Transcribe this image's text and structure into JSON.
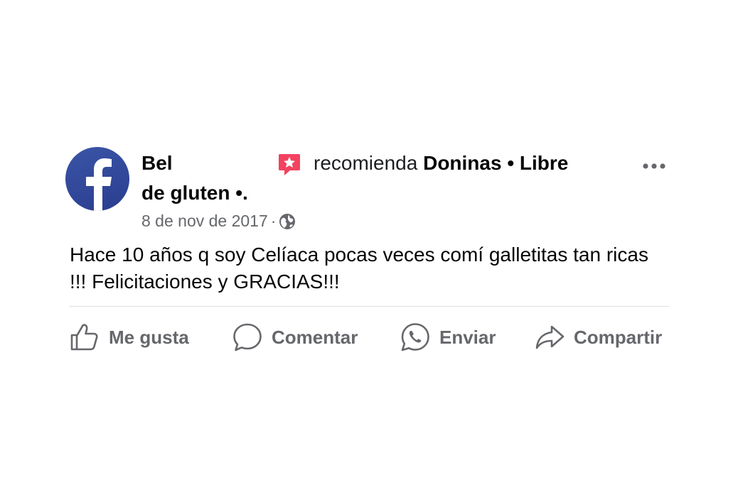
{
  "post": {
    "author_name_line1": "Bel",
    "author_name_line2": "de gluten",
    "author_suffix": "•.",
    "recommend_verb": "recomienda",
    "recommended_page": "Doninas • Libre",
    "date": "8 de nov de 2017",
    "meta_separator": "·",
    "privacy_icon": "globe-icon",
    "text": "Hace 10 años q soy Celíaca pocas veces comí galletitas tan ricas !!! Felicitaciones y GRACIAS!!!",
    "avatar_icon": "facebook-logo",
    "badge_icon": "recommend-star-icon"
  },
  "actions": {
    "like_label": "Me gusta",
    "comment_label": "Comentar",
    "send_label": "Enviar",
    "share_label": "Compartir"
  },
  "colors": {
    "avatar_blue": "#3b55a6",
    "badge_red": "#f3425f",
    "secondary_text": "#65676b",
    "divider": "#dadde1"
  }
}
